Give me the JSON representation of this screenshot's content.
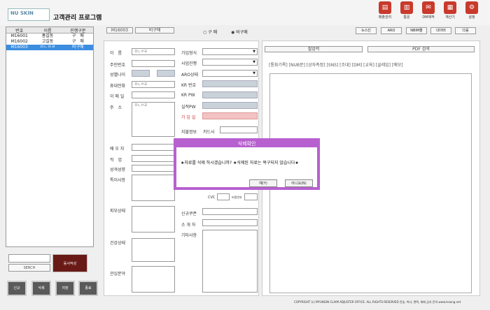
{
  "header": {
    "logo": "NU SKIN",
    "title": "고객관리 프로그램",
    "tools": [
      {
        "label": "매출관리",
        "icon": "chart-icon"
      },
      {
        "label": "통문",
        "icon": "document-icon"
      },
      {
        "label": "DM제작",
        "icon": "mail-icon"
      },
      {
        "label": "계산기",
        "icon": "calculator-icon"
      },
      {
        "label": "설정",
        "icon": "gear-icon"
      }
    ]
  },
  "list": {
    "headers": [
      "번호",
      "이름",
      "진행구분"
    ],
    "rows": [
      [
        "M16001",
        "홍길동",
        "구　매"
      ],
      [
        "M16002",
        "고길동",
        "구　매"
      ],
      [
        "M16003",
        "ㅁㄴㅇㄹ",
        "비구매"
      ]
    ]
  },
  "search": {
    "button": "SERCH",
    "action": "동서작성"
  },
  "bottom_buttons": [
    "신규",
    "삭제",
    "저장",
    "종료"
  ],
  "member": {
    "id": "M16003",
    "status": "비구매"
  },
  "radio": {
    "opt1": "구 매",
    "opt2": "비구매"
  },
  "top_buttons": [
    "뉴스킨",
    "ARO",
    "NBIM몰",
    "네이버",
    "다음"
  ],
  "form": {
    "name_label": "이　름",
    "name_value": "ㅁㄴㅇㄹ",
    "jumin_label": "주민번호",
    "age_label": "성별나이",
    "phone_label": "휴대전화",
    "phone_value": "ㅁㄴㅇㄹ",
    "email_label": "이 메 일",
    "addr_label": "주　소",
    "addr_value": "ㅁㄴㅇㄹ",
    "spouse_label": "배 우 자",
    "job_label": "직　업",
    "personality_label": "성격성향",
    "special_label": "특이사항",
    "skin_label": "피부상태",
    "health_label": "건강상태",
    "interest_label": "관심분야",
    "join_type": "가입형식",
    "business": "사업진행",
    "aro": "ARO상태",
    "kr_no": "KR 번호",
    "kr_pw": "KR PW",
    "site_pw": "실적PW",
    "join_date": "가 입 일",
    "pay_info": "지불정보",
    "card_company": "카드사",
    "cvc": "CVC",
    "pin": "비밀번호",
    "coupon": "신규쿠폰",
    "referrer": "소 개 자",
    "other": "기타사항"
  },
  "right": {
    "tabs": "[통화기록] [NUB문] [상자측정] [SNS] [조대] [DM] [교육] [골레임] [메모]",
    "btn1": "필업력",
    "btn2": "PDF 검색"
  },
  "footer": "COPYRIGHT (c) MYUNGIN CLAIM ADJUSTER OFFICE. ALL RIGHTS RESERVED 전송, 복사, 편택, 재배 금지 문의 www.lesang.net",
  "dialog": {
    "title": "삭제확인",
    "message": "★자료를 삭제 하시겠습니까? ★삭제된 자료는 복구되지 않습니다★",
    "yes": "예(Y)",
    "no": "아니요(N)"
  }
}
